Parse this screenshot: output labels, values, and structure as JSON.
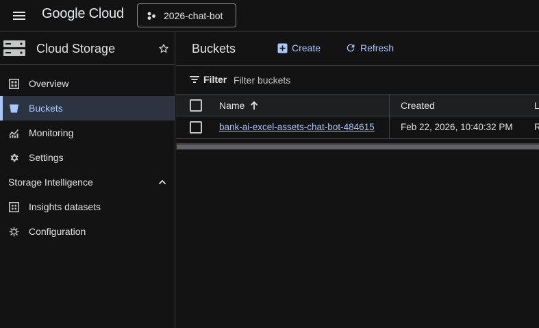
{
  "topbar": {
    "logo": "Google Cloud",
    "project": "2026-chat-bot",
    "icons": {
      "menu": "hamburger-menu-icon",
      "project": "project-hierarchy-icon"
    }
  },
  "sidebar": {
    "title": "Cloud Storage",
    "items": [
      {
        "label": "Overview",
        "icon": "dashboard-icon"
      },
      {
        "label": "Buckets",
        "icon": "bucket-icon"
      },
      {
        "label": "Monitoring",
        "icon": "monitoring-icon"
      },
      {
        "label": "Settings",
        "icon": "gear-icon"
      }
    ],
    "section": {
      "label": "Storage Intelligence",
      "expanded": true
    },
    "section_items": [
      {
        "label": "Insights datasets",
        "icon": "dataset-icon"
      },
      {
        "label": "Configuration",
        "icon": "configuration-icon"
      }
    ],
    "active_index": 1
  },
  "main": {
    "title": "Buckets",
    "actions": {
      "create": "Create",
      "refresh": "Refresh"
    },
    "filter": {
      "label": "Filter",
      "placeholder": "Filter buckets"
    },
    "table": {
      "columns": {
        "name": "Name",
        "created": "Created",
        "location": "L"
      },
      "rows": [
        {
          "name": "bank-ai-excel-assets-chat-bot-484615",
          "created": "Feb 22, 2026, 10:40:32 PM",
          "location": "R"
        }
      ]
    }
  },
  "colors": {
    "accent": "#a8c7fa",
    "background": "#131314",
    "active_bg": "#2d3441",
    "border": "#3c4043"
  }
}
